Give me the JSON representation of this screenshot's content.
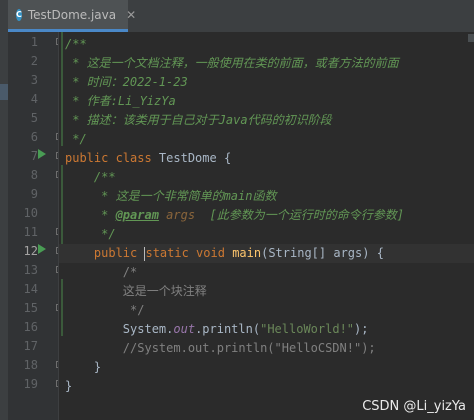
{
  "tab": {
    "icon_letter": "C",
    "label": "TestDome.java",
    "close": "✕"
  },
  "gutter": {
    "line_numbers": [
      "1",
      "2",
      "3",
      "4",
      "5",
      "6",
      "7",
      "8",
      "9",
      "10",
      "11",
      "12",
      "13",
      "14",
      "15",
      "16",
      "17",
      "18",
      "19"
    ],
    "current_line": "12"
  },
  "code": {
    "l1": "/**",
    "l2": " * 这是一个文档注释，一般使用在类的前面，或者方法的前面",
    "l3": " * 时间：2022-1-23",
    "l4": " * 作者:Li_YizYa",
    "l5": " * 描述：该类用于自己对于Java代码的初识阶段",
    "l6": " */",
    "l7_kw": "public class",
    "l7_rest": " TestDome {",
    "l8": "    /**",
    "l9": "     * 这是一个非常简单的main函数",
    "l10_pre": "     * ",
    "l10_tag": "@param",
    "l10_val": " args",
    "l10_desc": "  [此参数为一个运行时的命令行参数]",
    "l11": "     */",
    "l12_kw1": "    public",
    "l12_kw2": "static void",
    "l12_fn": " main",
    "l12_rest": "(String[] args) {",
    "l13": "        /*",
    "l14": "        这是一个块注释",
    "l15": "         */",
    "l16_a": "        System.",
    "l16_fld": "out",
    "l16_b": ".println(",
    "l16_str": "\"HelloWorld!\"",
    "l16_c": ");",
    "l17": "        //System.out.println(\"HelloCSDN!\");",
    "l18": "    }",
    "l19": "}"
  },
  "watermark": "CSDN @Li_yizYa"
}
